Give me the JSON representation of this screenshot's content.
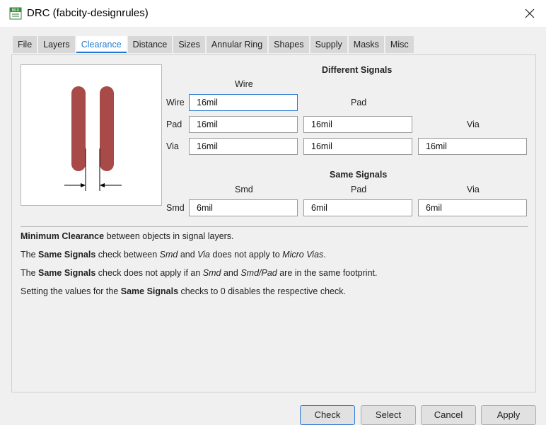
{
  "window": {
    "title": "DRC (fabcity-designrules)",
    "icon_text": "BRD"
  },
  "tabs": [
    {
      "label": "File"
    },
    {
      "label": "Layers"
    },
    {
      "label": "Clearance",
      "active": true
    },
    {
      "label": "Distance"
    },
    {
      "label": "Sizes"
    },
    {
      "label": "Annular Ring"
    },
    {
      "label": "Shapes"
    },
    {
      "label": "Supply"
    },
    {
      "label": "Masks"
    },
    {
      "label": "Misc"
    }
  ],
  "different_signals": {
    "title": "Different Signals",
    "col_wire": "Wire",
    "col_pad": "Pad",
    "col_via": "Via",
    "row_wire": "Wire",
    "row_pad": "Pad",
    "row_via": "Via",
    "wire_wire": "16mil",
    "pad_wire": "16mil",
    "pad_pad": "16mil",
    "via_wire": "16mil",
    "via_pad": "16mil",
    "via_via": "16mil"
  },
  "same_signals": {
    "title": "Same Signals",
    "col_smd": "Smd",
    "col_pad": "Pad",
    "col_via": "Via",
    "row_smd": "Smd",
    "smd_smd": "6mil",
    "smd_pad": "6mil",
    "smd_via": "6mil"
  },
  "notes": {
    "n1_bold": "Minimum Clearance",
    "n1_rest": " between objects in signal layers.",
    "n2_a": "The ",
    "n2_bold": "Same Signals",
    "n2_b": " check between ",
    "n2_i1": "Smd",
    "n2_c": " and ",
    "n2_i2": "Via",
    "n2_d": " does not apply to ",
    "n2_i3": "Micro Vias",
    "n2_e": ".",
    "n3_a": "The ",
    "n3_bold": "Same Signals",
    "n3_b": " check does not apply if an ",
    "n3_i1": "Smd",
    "n3_c": " and ",
    "n3_i2": "Smd/Pad",
    "n3_d": " are in the same footprint.",
    "n4_a": "Setting the values for the ",
    "n4_bold": "Same Signals",
    "n4_b": " checks to 0 disables the respective check."
  },
  "buttons": {
    "check": "Check",
    "select": "Select",
    "cancel": "Cancel",
    "apply": "Apply"
  },
  "colors": {
    "trace": "#a84a48",
    "accent": "#1f7bd1"
  },
  "icons": {
    "app": "brd-file-icon",
    "close": "close-icon"
  }
}
